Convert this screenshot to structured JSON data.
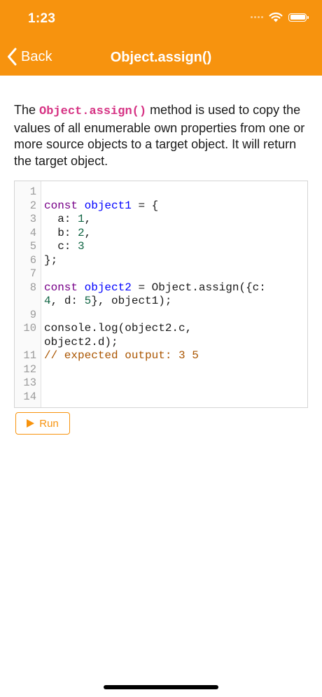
{
  "status_bar": {
    "time": "1:23",
    "icons": [
      "signal-dots-icon",
      "wifi-icon",
      "battery-icon"
    ]
  },
  "nav": {
    "back_label": "Back",
    "title": "Object.assign()",
    "back_icon": "chevron-left-icon"
  },
  "description": {
    "prefix": "The ",
    "code": "Object.assign()",
    "suffix": " method is used to copy the values of all enumerable own properties from one or more source objects to a target object. It will return the target object."
  },
  "editor": {
    "line_numbers": [
      "1",
      "2",
      "3",
      "4",
      "5",
      "6",
      "7",
      "8",
      "",
      "9",
      "10",
      "",
      "11",
      "12",
      "13",
      "14"
    ],
    "lines": [
      [],
      [
        {
          "t": "const",
          "c": "kw"
        },
        {
          "t": " "
        },
        {
          "t": "object1",
          "c": "def"
        },
        {
          "t": " = {"
        }
      ],
      [
        {
          "t": "  a: "
        },
        {
          "t": "1",
          "c": "num"
        },
        {
          "t": ","
        }
      ],
      [
        {
          "t": "  b: "
        },
        {
          "t": "2",
          "c": "num"
        },
        {
          "t": ","
        }
      ],
      [
        {
          "t": "  c: "
        },
        {
          "t": "3",
          "c": "num"
        }
      ],
      [
        {
          "t": "};"
        }
      ],
      [],
      [
        {
          "t": "const",
          "c": "kw"
        },
        {
          "t": " "
        },
        {
          "t": "object2",
          "c": "def"
        },
        {
          "t": " = Object.assign({c:"
        }
      ],
      [
        {
          "t": "4",
          "c": "num"
        },
        {
          "t": ", d: "
        },
        {
          "t": "5",
          "c": "num"
        },
        {
          "t": "}, object1);"
        }
      ],
      [],
      [
        {
          "t": "console.log(object2.c,"
        }
      ],
      [
        {
          "t": "object2.d);"
        }
      ],
      [
        {
          "t": "// expected output: 3 5",
          "c": "cm"
        }
      ],
      [],
      [],
      []
    ]
  },
  "run_button": {
    "label": "Run",
    "icon": "play-icon"
  },
  "colors": {
    "accent": "#f7930e",
    "keyword": "#770088",
    "definition": "#0000ff",
    "number": "#116644",
    "comment": "#aa5500",
    "inline_code": "#d63384"
  }
}
